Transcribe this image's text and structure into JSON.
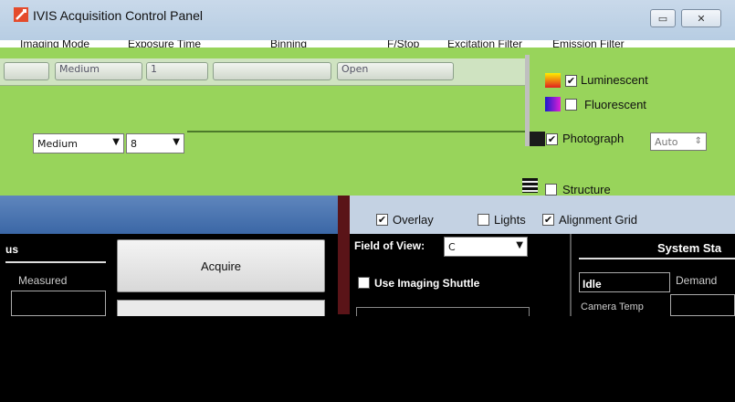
{
  "window": {
    "title": "IVIS Acquisition Control Panel",
    "minimize_glyph": "▭",
    "close_glyph": "✕"
  },
  "menu": {
    "items": [
      "Imaging Mode",
      "Exposure Time",
      "Binning",
      "F/Stop",
      "Excitation Filter",
      "Emission Filter"
    ]
  },
  "toolbar_strip": {
    "combo1": "Medium",
    "combo2": "8",
    "open_label": "Open",
    "medium_small": "Medium",
    "one_label": "1"
  },
  "imaging_types": [
    {
      "name": "Luminescent",
      "checked": true,
      "color": "#d8232a"
    },
    {
      "name": "Fluorescent",
      "checked": false,
      "color": "#2233cc"
    },
    {
      "name": "Photograph",
      "checked": true,
      "color": "#222"
    },
    {
      "name": "Structure",
      "checked": false,
      "color": "#333"
    }
  ],
  "auto_label": "Auto",
  "overlay_bar": {
    "overlay": {
      "label": "Overlay",
      "checked": true
    },
    "lights": {
      "label": "Lights",
      "checked": false
    },
    "alignment": {
      "label": "Alignment Grid",
      "checked": true
    }
  },
  "field_of_view": {
    "label": "Field of View:",
    "value": "C"
  },
  "shutter_label": "Use Imaging Shuttle",
  "acquire_label": "Acquire",
  "status_label": "us",
  "measured_label": "Measured",
  "system_status": {
    "title": "System Sta",
    "state": "Idle",
    "demand_label": "Demand",
    "camera_label": "Camera Temp"
  },
  "colors": {
    "green": "#98d45b",
    "blue": "#3b67a6",
    "maroon": "#5a1418"
  }
}
